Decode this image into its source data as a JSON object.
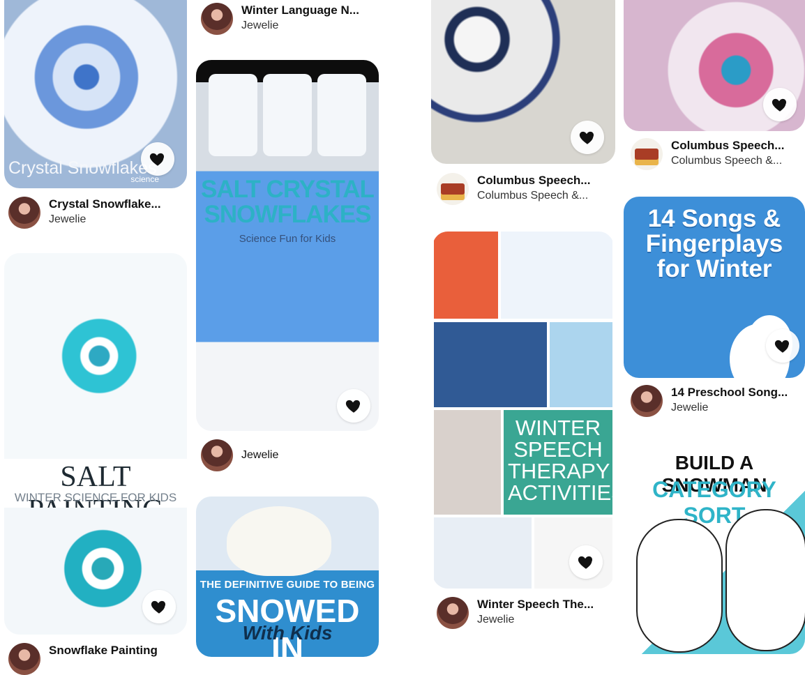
{
  "pins": [
    {
      "title": "Crystal Snowflake...",
      "subtitle": "Jewelie",
      "image_text": "Crystal Snowflakes",
      "image_subtext": "science"
    },
    {
      "title": "",
      "subtitle": "",
      "image_text": "SALT PAINTING",
      "image_subtext": "WINTER SCIENCE FOR KIDS"
    },
    {
      "title": "Snowflake Painting",
      "subtitle": ""
    },
    {
      "title": "Winter Language N...",
      "subtitle": "Jewelie"
    },
    {
      "title": "",
      "subtitle": "Jewelie",
      "image_text": "SALT CRYSTAL SNOWFLAKES",
      "image_subtext": "Science Fun for Kids"
    },
    {
      "title": "",
      "subtitle": "",
      "image_text": "THE DEFINITIVE GUIDE TO BEING",
      "image_big": "SNOWED IN",
      "image_script": "With Kids"
    },
    {
      "title": "Columbus Speech...",
      "subtitle": "Columbus Speech &..."
    },
    {
      "title": "Winter Speech The...",
      "subtitle": "Jewelie",
      "image_text": "WINTER SPEECH THERAPY ACTIVITIES"
    },
    {
      "title": "Columbus Speech...",
      "subtitle": "Columbus Speech &..."
    },
    {
      "title": "14 Preschool Song...",
      "subtitle": "Jewelie",
      "image_text": "14 Songs & Fingerplays for Winter"
    },
    {
      "title": "",
      "subtitle": "",
      "image_text": "BUILD A SNOWMAN",
      "image_subtext": "CATEGORY SORT"
    }
  ],
  "colors": {
    "heart": "#111111",
    "accent_blue": "#3d8fd8",
    "teal": "#3aa693"
  }
}
